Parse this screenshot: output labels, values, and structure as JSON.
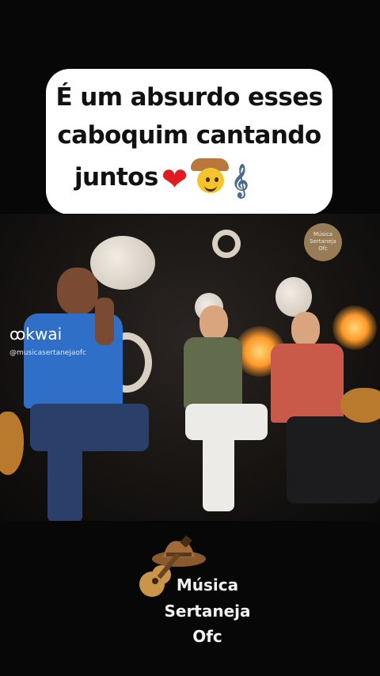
{
  "caption": {
    "line1": "É um absurdo esses",
    "line2": "caboquim cantando",
    "line3": "juntos",
    "emojis": [
      "red-heart",
      "cowboy-face",
      "musical-score"
    ]
  },
  "video": {
    "kwai_logo": "kwai",
    "kwai_handle": "@musicasertanejaofc",
    "watermark": [
      "Música",
      "Sertaneja",
      "Ofc"
    ]
  },
  "brand": {
    "line1": "Música",
    "line2": "Sertaneja",
    "line3": "Ofc"
  },
  "colors": {
    "background": "#070707",
    "card": "#ffffff",
    "text_dark": "#111111",
    "heart": "#e11b22",
    "hat_brown": "#b9773b"
  }
}
